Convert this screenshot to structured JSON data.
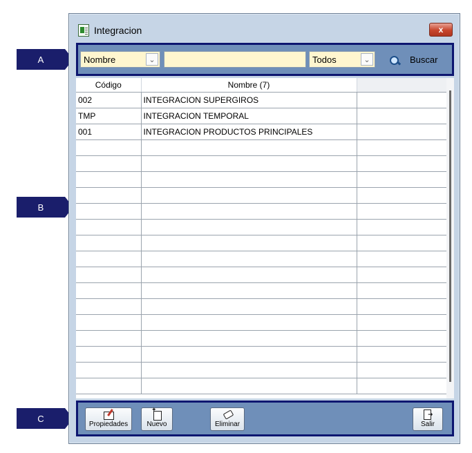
{
  "callouts": {
    "a": "A",
    "b": "B",
    "c": "C"
  },
  "window": {
    "title": "Integracion",
    "close_label": "x"
  },
  "toolbar": {
    "field_combo": "Nombre",
    "search_value": "",
    "filter_combo": "Todos",
    "search_button": "Buscar"
  },
  "grid": {
    "columns": [
      "Código",
      "Nombre (7)",
      ""
    ],
    "rows": [
      [
        "002",
        "INTEGRACION SUPERGIROS",
        ""
      ],
      [
        "TMP",
        "INTEGRACION TEMPORAL",
        ""
      ],
      [
        "001",
        "INTEGRACION PRODUCTOS PRINCIPALES",
        ""
      ],
      [
        "",
        "",
        ""
      ],
      [
        "",
        "",
        ""
      ],
      [
        "",
        "",
        ""
      ],
      [
        "",
        "",
        ""
      ],
      [
        "",
        "",
        ""
      ],
      [
        "",
        "",
        ""
      ],
      [
        "",
        "",
        ""
      ],
      [
        "",
        "",
        ""
      ],
      [
        "",
        "",
        ""
      ],
      [
        "",
        "",
        ""
      ],
      [
        "",
        "",
        ""
      ],
      [
        "",
        "",
        ""
      ],
      [
        "",
        "",
        ""
      ],
      [
        "",
        "",
        ""
      ],
      [
        "",
        "",
        ""
      ],
      [
        "",
        "",
        ""
      ]
    ]
  },
  "footer": {
    "propiedades": "Propiedades",
    "nuevo": "Nuevo",
    "eliminar": "Eliminar",
    "salir": "Salir"
  }
}
